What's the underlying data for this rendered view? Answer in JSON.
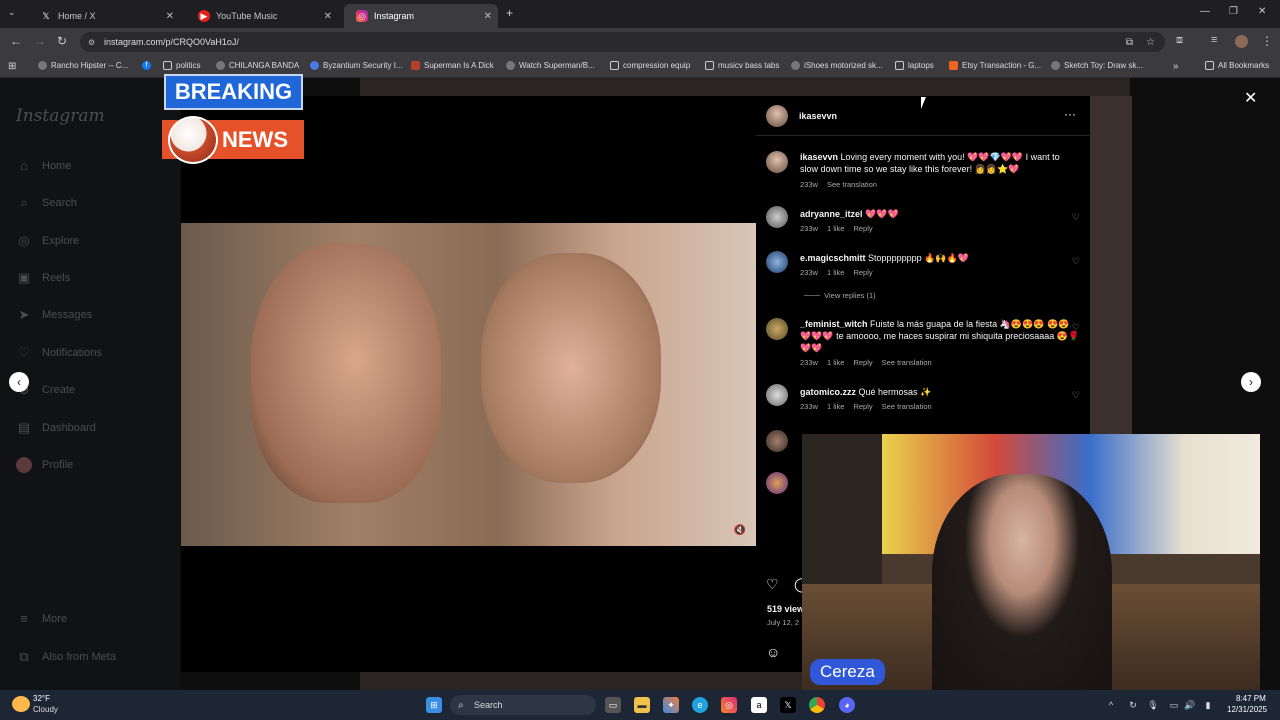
{
  "tabs": [
    {
      "label": "Home / X",
      "icon": "x-logo-icon"
    },
    {
      "label": "YouTube Music",
      "icon": "youtube-music-icon"
    },
    {
      "label": "Instagram",
      "icon": "instagram-icon"
    }
  ],
  "address": {
    "url": "instagram.com/p/CRQO0VaH1oJ/"
  },
  "bookmarks": [
    {
      "label": "Rancho Hipster -- C..."
    },
    {
      "label": ""
    },
    {
      "label": "politics"
    },
    {
      "label": "CHILANGA BANDA"
    },
    {
      "label": "Byzantium Security I..."
    },
    {
      "label": "Superman Is A Dick"
    },
    {
      "label": "Watch Superman/B..."
    },
    {
      "label": "compression equip"
    },
    {
      "label": "musicv bass tabs"
    },
    {
      "label": "iShoes motorized sk..."
    },
    {
      "label": "laptops"
    },
    {
      "label": "Etsy Transaction - G..."
    },
    {
      "label": "Sketch Toy: Draw sk..."
    }
  ],
  "all_bookmarks": "All Bookmarks",
  "instagram": {
    "logo": "Instagram",
    "nav": [
      {
        "label": "Home",
        "icon": "home-icon"
      },
      {
        "label": "Search",
        "icon": "search-icon"
      },
      {
        "label": "Explore",
        "icon": "compass-icon"
      },
      {
        "label": "Reels",
        "icon": "reels-icon"
      },
      {
        "label": "Messages",
        "icon": "messages-icon"
      },
      {
        "label": "Notifications",
        "icon": "heart-icon"
      },
      {
        "label": "Create",
        "icon": "plus-icon"
      },
      {
        "label": "Dashboard",
        "icon": "dashboard-icon"
      },
      {
        "label": "Profile",
        "icon": "avatar-icon"
      }
    ],
    "more": "More",
    "also_from_meta": "Also from Meta"
  },
  "post": {
    "username": "ikasevvn",
    "caption_user": "ikasevvn",
    "caption": "Loving every moment with you! 💖💖💎💖💖 I want to slow down time so we stay like this forever! 👩👩⭐💖",
    "caption_meta": {
      "time": "233w",
      "see_translation": "See translation"
    },
    "comments": [
      {
        "user": "adryanne_itzel",
        "text": "💖💖💖",
        "time": "233w",
        "likes": "1 like",
        "reply": "Reply"
      },
      {
        "user": "e.magicschmitt",
        "text": "Stopppppppp 🔥🙌🔥💖",
        "time": "233w",
        "likes": "1 like",
        "reply": "Reply",
        "view_replies": "View replies (1)"
      },
      {
        "user": "_feminist_witch",
        "text": "Fuiste la más guapa de la fiesta 🦄😍😍😍 😍😍💖💖💖 te amoooo, me haces suspirar mi shiquita preciosaaaa 😍🌹💖💖",
        "time": "233w",
        "likes": "1 like",
        "reply": "Reply",
        "see_translation": "See translation"
      },
      {
        "user": "gatomico.zzz",
        "text": "Qué hermosas ✨",
        "time": "233w",
        "likes": "1 like",
        "reply": "Reply",
        "see_translation": "See translation"
      }
    ],
    "views": "519 view",
    "date": "July 12, 2"
  },
  "overlay": {
    "breaking": "BREAKING",
    "news": "NEWS",
    "pip_tag": "Cereza"
  },
  "taskbar": {
    "weather_temp": "32°F",
    "weather_text": "Cloudy",
    "search": "Search",
    "time": "8:47 PM",
    "date": "12/31/2025"
  }
}
